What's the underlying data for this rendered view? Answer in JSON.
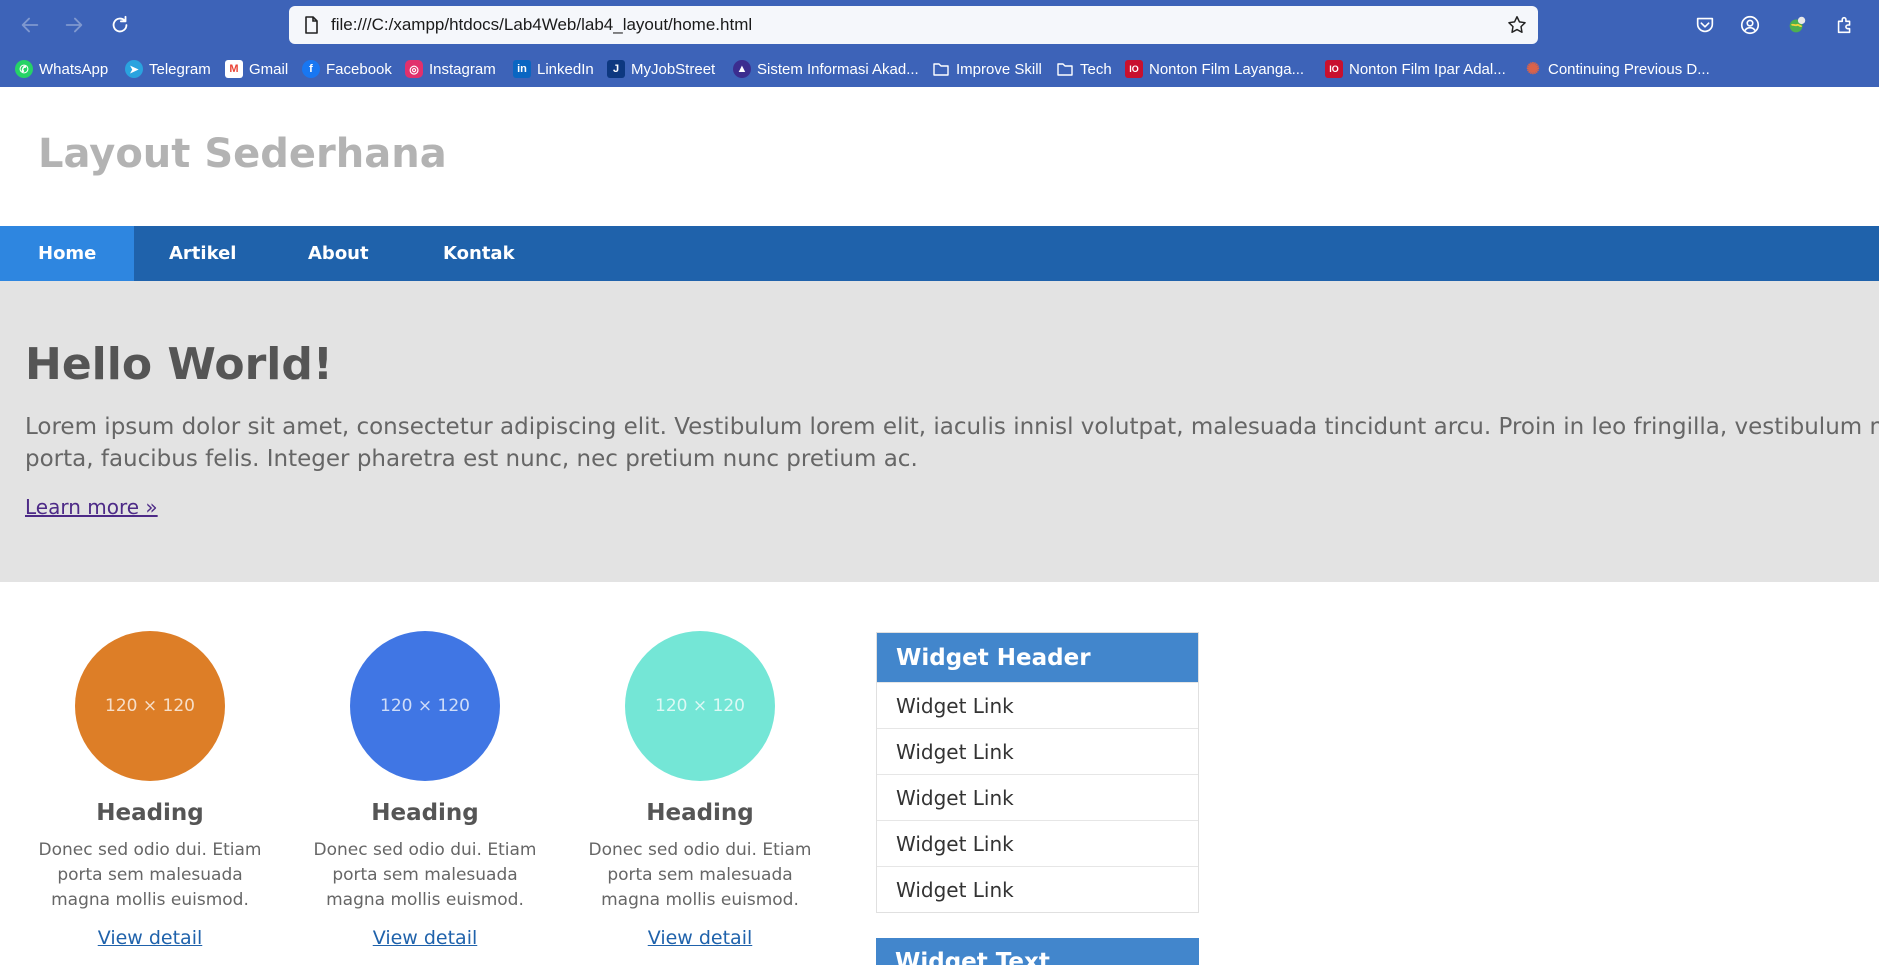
{
  "browser": {
    "url": "file:///C:/xampp/htdocs/Lab4Web/lab4_layout/home.html",
    "bookmarks": [
      {
        "label": "WhatsApp",
        "icon": "whatsapp-icon",
        "color": "#25d366"
      },
      {
        "label": "Telegram",
        "icon": "telegram-icon",
        "color": "#2aa3df"
      },
      {
        "label": "Gmail",
        "icon": "gmail-icon",
        "color": "#ea4335"
      },
      {
        "label": "Facebook",
        "icon": "facebook-icon",
        "color": "#1877f2"
      },
      {
        "label": "Instagram",
        "icon": "instagram-icon",
        "color": "#e1306c"
      },
      {
        "label": "LinkedIn",
        "icon": "linkedin-icon",
        "color": "#0a66c2"
      },
      {
        "label": "MyJobStreet",
        "icon": "jobstreet-icon",
        "color": "#0d3880"
      },
      {
        "label": "Sistem Informasi Akad...",
        "icon": "university-icon",
        "color": "#3b2d8f"
      },
      {
        "label": "Improve Skill",
        "icon": "folder-icon",
        "color": "#ffffff"
      },
      {
        "label": "Tech",
        "icon": "folder-icon",
        "color": "#ffffff"
      },
      {
        "label": "Nonton Film Layanga...",
        "icon": "film-icon",
        "color": "#c8102e"
      },
      {
        "label": "Nonton Film Ipar Adal...",
        "icon": "film-icon",
        "color": "#c8102e"
      },
      {
        "label": "Continuing Previous D...",
        "icon": "burst-icon",
        "color": "#d9624a"
      }
    ]
  },
  "site": {
    "title": "Layout Sederhana",
    "nav": [
      "Home",
      "Artikel",
      "About",
      "Kontak"
    ],
    "active_nav": "Home"
  },
  "hero": {
    "heading": "Hello World!",
    "lead": "Lorem ipsum dolor sit amet, consectetur adipiscing elit. Vestibulum lorem elit, iaculis innisl volutpat, malesuada tincidunt arcu. Proin in leo fringilla, vestibulum mi porta, faucibus felis. Integer pharetra est nunc, nec pretium nunc pretium ac.",
    "link": "Learn more »"
  },
  "features": [
    {
      "image_text": "120 × 120",
      "color": "#dd7e27",
      "heading": "Heading",
      "text": "Donec sed odio dui. Etiam porta sem malesuada magna mollis euismod.",
      "link": "View detail"
    },
    {
      "image_text": "120 × 120",
      "color": "#4076e4",
      "heading": "Heading",
      "text": "Donec sed odio dui. Etiam porta sem malesuada magna mollis euismod.",
      "link": "View detail"
    },
    {
      "image_text": "120 × 120",
      "color": "#74e6d6",
      "heading": "Heading",
      "text": "Donec sed odio dui. Etiam porta sem malesuada magna mollis euismod.",
      "link": "View detail"
    }
  ],
  "widget": {
    "header": "Widget Header",
    "links": [
      "Widget Link",
      "Widget Link",
      "Widget Link",
      "Widget Link",
      "Widget Link"
    ]
  },
  "widget2": {
    "header": "Widget Text"
  }
}
